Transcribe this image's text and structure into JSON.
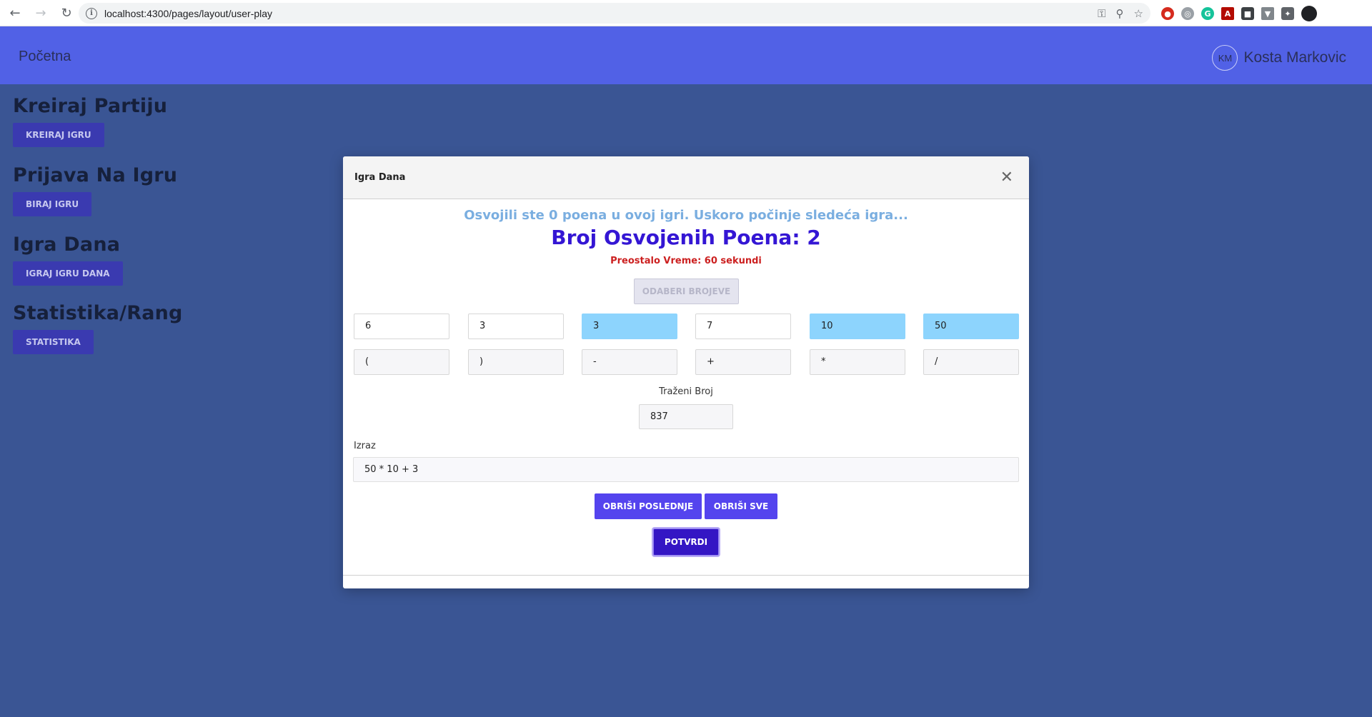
{
  "browser": {
    "url": "localhost:4300/pages/layout/user-play"
  },
  "navbar": {
    "brand": "Početna",
    "user_initials": "KM",
    "user_name": "Kosta Markovic"
  },
  "sidebar": {
    "sections": [
      {
        "title": "Kreiraj Partiju",
        "button": "KREIRAJ IGRU"
      },
      {
        "title": "Prijava Na Igru",
        "button": "BIRAJ IGRU"
      },
      {
        "title": "Igra Dana",
        "button": "IGRAJ IGRU DANA"
      },
      {
        "title": "Statistika/Rang",
        "button": "STATISTIKA"
      }
    ]
  },
  "modal": {
    "title": "Igra Dana",
    "info_message": "Osvojili ste 0 poena u ovoj igri. Uskoro počinje sledeća igra...",
    "score_message": "Broj Osvojenih Poena: 2",
    "time_message": "Preostalo Vreme: 60 sekundi",
    "pick_numbers_label": "ODABERI BROJEVE",
    "numbers": [
      {
        "value": "6",
        "selected": false
      },
      {
        "value": "3",
        "selected": false
      },
      {
        "value": "3",
        "selected": true
      },
      {
        "value": "7",
        "selected": false
      },
      {
        "value": "10",
        "selected": true
      },
      {
        "value": "50",
        "selected": true
      }
    ],
    "operators": [
      "(",
      ")",
      "-",
      "+",
      "*",
      "/"
    ],
    "target_label": "Traženi Broj",
    "target_value": "837",
    "expression_label": "Izraz",
    "expression_value": "50 * 10 + 3",
    "delete_last_label": "OBRIŠI POSLEDNJE",
    "delete_all_label": "OBRIŠI SVE",
    "confirm_label": "POTVRDI"
  },
  "colors": {
    "navbar": "#5161e6",
    "background": "#3a5594",
    "selected_number": "#8dd4fd",
    "action_button": "#5444ee",
    "score_text": "#3416d4",
    "time_text": "#cc2020"
  }
}
